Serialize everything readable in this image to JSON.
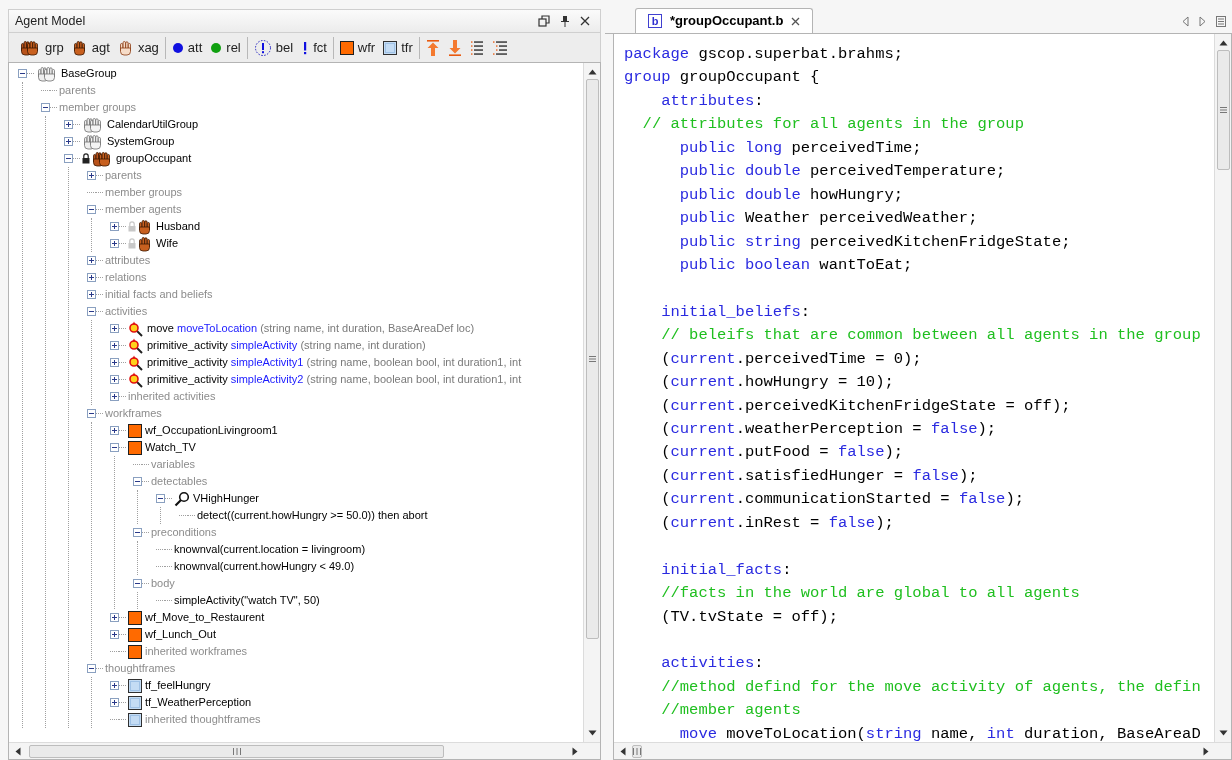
{
  "panel": {
    "title": "Agent Model"
  },
  "toolbar": [
    [
      {
        "kind": "group",
        "label": "grp"
      },
      {
        "kind": "agent",
        "label": "agt"
      },
      {
        "kind": "external_agent",
        "label": "xag"
      }
    ],
    [
      {
        "kind": "attribute",
        "label": "att"
      },
      {
        "kind": "relation",
        "label": "rel"
      }
    ],
    [
      {
        "kind": "belief",
        "label": "bel"
      },
      {
        "kind": "fact",
        "label": "fct"
      }
    ],
    [
      {
        "kind": "workframe",
        "label": "wfr"
      },
      {
        "kind": "thoughtframe",
        "label": "tfr"
      }
    ],
    [
      {
        "kind": "move_up"
      },
      {
        "kind": "move_down"
      },
      {
        "kind": "expand_all"
      },
      {
        "kind": "collapse_all"
      }
    ]
  ],
  "tree": [
    {
      "kind": "library_group",
      "label": "BaseGroup",
      "expanded": true,
      "children": [
        {
          "kind": "section",
          "label": "parents"
        },
        {
          "kind": "section",
          "label": "member groups",
          "expanded": true,
          "children": [
            {
              "kind": "library_group",
              "label": "CalendarUtilGroup",
              "expanded": false
            },
            {
              "kind": "library_group",
              "label": "SystemGroup",
              "expanded": false
            },
            {
              "kind": "group",
              "label": "groupOccupant",
              "locked": true,
              "expanded": true,
              "children": [
                {
                  "kind": "section",
                  "label": "parents",
                  "expanded": false
                },
                {
                  "kind": "section",
                  "label": "member groups"
                },
                {
                  "kind": "section",
                  "label": "member agents",
                  "expanded": true,
                  "children": [
                    {
                      "kind": "agent",
                      "label": "Husband",
                      "locked": false,
                      "expanded": false
                    },
                    {
                      "kind": "agent",
                      "label": "Wife",
                      "locked": false,
                      "expanded": false
                    }
                  ]
                },
                {
                  "kind": "section",
                  "label": "attributes",
                  "expanded": false
                },
                {
                  "kind": "section",
                  "label": "relations",
                  "expanded": false
                },
                {
                  "kind": "section",
                  "label": "initial facts and beliefs",
                  "expanded": false
                },
                {
                  "kind": "section",
                  "label": "activities",
                  "expanded": true,
                  "children": [
                    {
                      "kind": "activity",
                      "keyword": "move",
                      "name": "moveToLocation",
                      "params": "(string name, int duration, BaseAreaDef loc)",
                      "expanded": false
                    },
                    {
                      "kind": "activity",
                      "keyword": "primitive_activity",
                      "name": "simpleActivity",
                      "params": "(string name, int duration)",
                      "expanded": false
                    },
                    {
                      "kind": "activity",
                      "keyword": "primitive_activity",
                      "name": "simpleActivity1",
                      "params": "(string name, boolean bool, int duration1, int",
                      "expanded": false
                    },
                    {
                      "kind": "activity",
                      "keyword": "primitive_activity",
                      "name": "simpleActivity2",
                      "params": "(string name, boolean bool, int duration1, int",
                      "expanded": false
                    },
                    {
                      "kind": "section",
                      "label": "inherited activities",
                      "expanded": false
                    }
                  ]
                },
                {
                  "kind": "section",
                  "label": "workframes",
                  "expanded": true,
                  "children": [
                    {
                      "kind": "workframe",
                      "label": "wf_OccupationLivingroom1",
                      "expanded": false
                    },
                    {
                      "kind": "workframe",
                      "label": "Watch_TV",
                      "expanded": true,
                      "children": [
                        {
                          "kind": "section",
                          "label": "variables"
                        },
                        {
                          "kind": "section",
                          "label": "detectables",
                          "expanded": true,
                          "children": [
                            {
                              "kind": "detectable",
                              "label": "VHighHunger",
                              "expanded": true,
                              "children": [
                                {
                                  "kind": "statement",
                                  "label": "detect((current.howHungry >= 50.0)) then abort"
                                }
                              ]
                            }
                          ]
                        },
                        {
                          "kind": "section",
                          "label": "preconditions",
                          "expanded": true,
                          "children": [
                            {
                              "kind": "statement",
                              "label": "knownval(current.location = livingroom)"
                            },
                            {
                              "kind": "statement",
                              "label": "knownval(current.howHungry < 49.0)"
                            }
                          ]
                        },
                        {
                          "kind": "section",
                          "label": "body",
                          "expanded": true,
                          "children": [
                            {
                              "kind": "statement",
                              "label": "simpleActivity(\"watch TV\", 50)"
                            }
                          ]
                        }
                      ]
                    },
                    {
                      "kind": "workframe",
                      "label": "wf_Move_to_Restaurent",
                      "expanded": false
                    },
                    {
                      "kind": "workframe",
                      "label": "wf_Lunch_Out",
                      "expanded": false
                    },
                    {
                      "kind": "inherited_workframe",
                      "label": "inherited workframes"
                    }
                  ]
                },
                {
                  "kind": "section",
                  "label": "thoughtframes",
                  "expanded": true,
                  "children": [
                    {
                      "kind": "thoughtframe",
                      "label": "tf_feelHungry",
                      "expanded": false
                    },
                    {
                      "kind": "thoughtframe",
                      "label": "tf_WeatherPerception",
                      "expanded": false
                    },
                    {
                      "kind": "inherited_thoughtframe",
                      "label": "inherited thoughtframes"
                    }
                  ]
                }
              ]
            }
          ]
        }
      ]
    }
  ],
  "editor": {
    "tab": {
      "icon_letter": "b",
      "title": "*groupOccupant.b"
    },
    "lines": [
      {
        "kind": "code",
        "tokens": [
          {
            "kind": "kw",
            "text": "package"
          },
          {
            "kind": "plain",
            "text": " gscop.superbat.brahms;"
          }
        ]
      },
      {
        "kind": "code",
        "tokens": [
          {
            "kind": "kw",
            "text": "group"
          },
          {
            "kind": "plain",
            "text": " groupOccupant {"
          }
        ]
      },
      {
        "kind": "code",
        "tokens": [
          {
            "kind": "kw",
            "text": "    attributes"
          },
          {
            "kind": "plain",
            "text": ":"
          }
        ]
      },
      {
        "kind": "code",
        "tokens": [
          {
            "kind": "comment",
            "text": "  // attributes for all agents in the group"
          }
        ]
      },
      {
        "kind": "code",
        "tokens": [
          {
            "kind": "kw",
            "text": "      public long"
          },
          {
            "kind": "plain",
            "text": " perceivedTime;"
          }
        ]
      },
      {
        "kind": "code",
        "tokens": [
          {
            "kind": "kw",
            "text": "      public double"
          },
          {
            "kind": "plain",
            "text": " perceivedTemperature;"
          }
        ]
      },
      {
        "kind": "code",
        "tokens": [
          {
            "kind": "kw",
            "text": "      public double"
          },
          {
            "kind": "plain",
            "text": " howHungry;"
          }
        ]
      },
      {
        "kind": "code",
        "tokens": [
          {
            "kind": "kw",
            "text": "      public"
          },
          {
            "kind": "plain",
            "text": " Weather perceivedWeather;"
          }
        ]
      },
      {
        "kind": "code",
        "tokens": [
          {
            "kind": "kw",
            "text": "      public string"
          },
          {
            "kind": "plain",
            "text": " perceivedKitchenFridgeState;"
          }
        ]
      },
      {
        "kind": "code",
        "tokens": [
          {
            "kind": "kw",
            "text": "      public boolean"
          },
          {
            "kind": "plain",
            "text": " wantToEat;"
          }
        ]
      },
      {
        "kind": "blank"
      },
      {
        "kind": "code",
        "tokens": [
          {
            "kind": "kw",
            "text": "    initial_beliefs"
          },
          {
            "kind": "plain",
            "text": ":"
          }
        ]
      },
      {
        "kind": "code",
        "tokens": [
          {
            "kind": "comment",
            "text": "    // beleifs that are common between all agents in the group"
          }
        ]
      },
      {
        "kind": "code",
        "tokens": [
          {
            "kind": "plain",
            "text": "    ("
          },
          {
            "kind": "kw",
            "text": "current"
          },
          {
            "kind": "plain",
            "text": ".perceivedTime = 0);"
          }
        ]
      },
      {
        "kind": "code",
        "tokens": [
          {
            "kind": "plain",
            "text": "    ("
          },
          {
            "kind": "kw",
            "text": "current"
          },
          {
            "kind": "plain",
            "text": ".howHungry = 10);"
          }
        ]
      },
      {
        "kind": "code",
        "tokens": [
          {
            "kind": "plain",
            "text": "    ("
          },
          {
            "kind": "kw",
            "text": "current"
          },
          {
            "kind": "plain",
            "text": ".perceivedKitchenFridgeState = off);"
          }
        ]
      },
      {
        "kind": "code",
        "tokens": [
          {
            "kind": "plain",
            "text": "    ("
          },
          {
            "kind": "kw",
            "text": "current"
          },
          {
            "kind": "plain",
            "text": ".weatherPerception = "
          },
          {
            "kind": "kw",
            "text": "false"
          },
          {
            "kind": "plain",
            "text": ");"
          }
        ]
      },
      {
        "kind": "code",
        "tokens": [
          {
            "kind": "plain",
            "text": "    ("
          },
          {
            "kind": "kw",
            "text": "current"
          },
          {
            "kind": "plain",
            "text": ".putFood = "
          },
          {
            "kind": "kw",
            "text": "false"
          },
          {
            "kind": "plain",
            "text": ");"
          }
        ]
      },
      {
        "kind": "code",
        "tokens": [
          {
            "kind": "plain",
            "text": "    ("
          },
          {
            "kind": "kw",
            "text": "current"
          },
          {
            "kind": "plain",
            "text": ".satisfiedHunger = "
          },
          {
            "kind": "kw",
            "text": "false"
          },
          {
            "kind": "plain",
            "text": ");"
          }
        ]
      },
      {
        "kind": "code",
        "tokens": [
          {
            "kind": "plain",
            "text": "    ("
          },
          {
            "kind": "kw",
            "text": "current"
          },
          {
            "kind": "plain",
            "text": ".communicationStarted = "
          },
          {
            "kind": "kw",
            "text": "false"
          },
          {
            "kind": "plain",
            "text": ");"
          }
        ]
      },
      {
        "kind": "code",
        "tokens": [
          {
            "kind": "plain",
            "text": "    ("
          },
          {
            "kind": "kw",
            "text": "current"
          },
          {
            "kind": "plain",
            "text": ".inRest = "
          },
          {
            "kind": "kw",
            "text": "false"
          },
          {
            "kind": "plain",
            "text": ");"
          }
        ]
      },
      {
        "kind": "blank"
      },
      {
        "kind": "code",
        "tokens": [
          {
            "kind": "kw",
            "text": "    initial_facts"
          },
          {
            "kind": "plain",
            "text": ":"
          }
        ]
      },
      {
        "kind": "code",
        "tokens": [
          {
            "kind": "comment",
            "text": "    //facts in the world are global to all agents"
          }
        ]
      },
      {
        "kind": "code",
        "tokens": [
          {
            "kind": "plain",
            "text": "    (TV.tvState = off);"
          }
        ]
      },
      {
        "kind": "blank"
      },
      {
        "kind": "code",
        "tokens": [
          {
            "kind": "kw",
            "text": "    activities"
          },
          {
            "kind": "plain",
            "text": ":"
          }
        ]
      },
      {
        "kind": "code",
        "tokens": [
          {
            "kind": "comment",
            "text": "    //method defind for the move activity of agents, the defin"
          }
        ]
      },
      {
        "kind": "code",
        "tokens": [
          {
            "kind": "comment",
            "text": "    //member agents"
          }
        ]
      },
      {
        "kind": "code",
        "tokens": [
          {
            "kind": "kw",
            "text": "      move"
          },
          {
            "kind": "plain",
            "text": " moveToLocation("
          },
          {
            "kind": "kw",
            "text": "string"
          },
          {
            "kind": "plain",
            "text": " name, "
          },
          {
            "kind": "kw",
            "text": "int"
          },
          {
            "kind": "plain",
            "text": " duration, BaseAreaD"
          }
        ]
      }
    ]
  }
}
